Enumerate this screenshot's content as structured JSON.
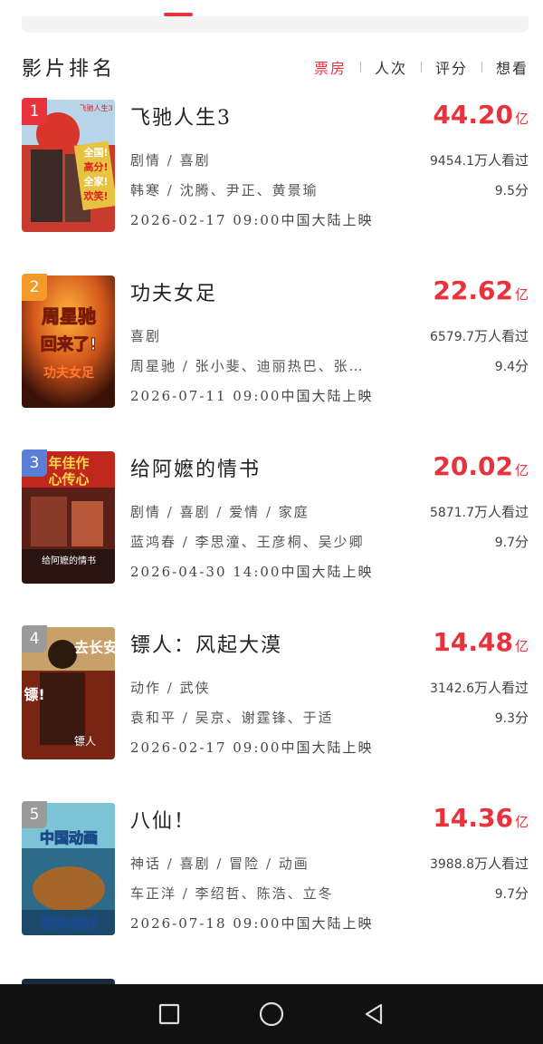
{
  "header": {
    "title": "影片排名",
    "tabs": [
      {
        "label": "票房",
        "active": true
      },
      {
        "label": "人次",
        "active": false
      },
      {
        "label": "评分",
        "active": false
      },
      {
        "label": "想看",
        "active": false
      }
    ]
  },
  "movies": [
    {
      "rank": "1",
      "title": "飞驰人生3",
      "box_office": "44.20",
      "unit": "亿",
      "genre": "剧情 / 喜剧",
      "viewers": "9454.1",
      "viewers_suffix": "万人看过",
      "cast": "韩寒 / 沈腾、尹正、黄景瑜",
      "score": "9.5",
      "score_suffix": "分",
      "release": "2026-02-17 09:00中国大陆上映",
      "badge_color": "#e8323c"
    },
    {
      "rank": "2",
      "title": "功夫女足",
      "box_office": "22.62",
      "unit": "亿",
      "genre": "喜剧",
      "viewers": "6579.7",
      "viewers_suffix": "万人看过",
      "cast": "周星驰 / 张小斐、迪丽热巴、张…",
      "score": "9.4",
      "score_suffix": "分",
      "release": "2026-07-11 09:00中国大陆上映",
      "badge_color": "#f39a2b"
    },
    {
      "rank": "3",
      "title": "给阿嬷的情书",
      "box_office": "20.02",
      "unit": "亿",
      "genre": "剧情 / 喜剧 / 爱情 / 家庭",
      "viewers": "5871.7",
      "viewers_suffix": "万人看过",
      "cast": "蓝鸿春 / 李思潼、王彦桐、吴少卿",
      "score": "9.7",
      "score_suffix": "分",
      "release": "2026-04-30 14:00中国大陆上映",
      "badge_color": "#5b7fd6"
    },
    {
      "rank": "4",
      "title": "镖人：风起大漠",
      "box_office": "14.48",
      "unit": "亿",
      "genre": "动作 / 武侠",
      "viewers": "3142.6",
      "viewers_suffix": "万人看过",
      "cast": "袁和平 / 吴京、谢霆锋、于适",
      "score": "9.3",
      "score_suffix": "分",
      "release": "2026-02-17 09:00中国大陆上映",
      "badge_color": "#9a9a9a"
    },
    {
      "rank": "5",
      "title": "八仙！",
      "box_office": "14.36",
      "unit": "亿",
      "genre": "神话 / 喜剧 / 冒险 / 动画",
      "viewers": "3988.8",
      "viewers_suffix": "万人看过",
      "cast": "车正洋 / 李绍哲、陈浩、立冬",
      "score": "9.7",
      "score_suffix": "分",
      "release": "2026-07-18 09:00中国大陆上映",
      "badge_color": "#9a9a9a"
    }
  ],
  "posters": [
    {
      "texts": [
        "飞驰人生3",
        "全国!",
        "高分!",
        "全家!",
        "欢笑!"
      ]
    },
    {
      "texts": [
        "周星驰",
        "回来了!",
        "功夫女足"
      ]
    },
    {
      "texts": [
        "年佳作",
        "心传心",
        "给阿嬷的情书"
      ]
    },
    {
      "texts": [
        "去长安",
        "镖!",
        "镖人"
      ]
    },
    {
      "texts": [
        "中国动画",
        "越来越好"
      ]
    }
  ],
  "nav": {
    "recent_icon": "square-icon",
    "home_icon": "circle-icon",
    "back_icon": "triangle-back-icon"
  },
  "colors": {
    "accent": "#e8323c"
  }
}
